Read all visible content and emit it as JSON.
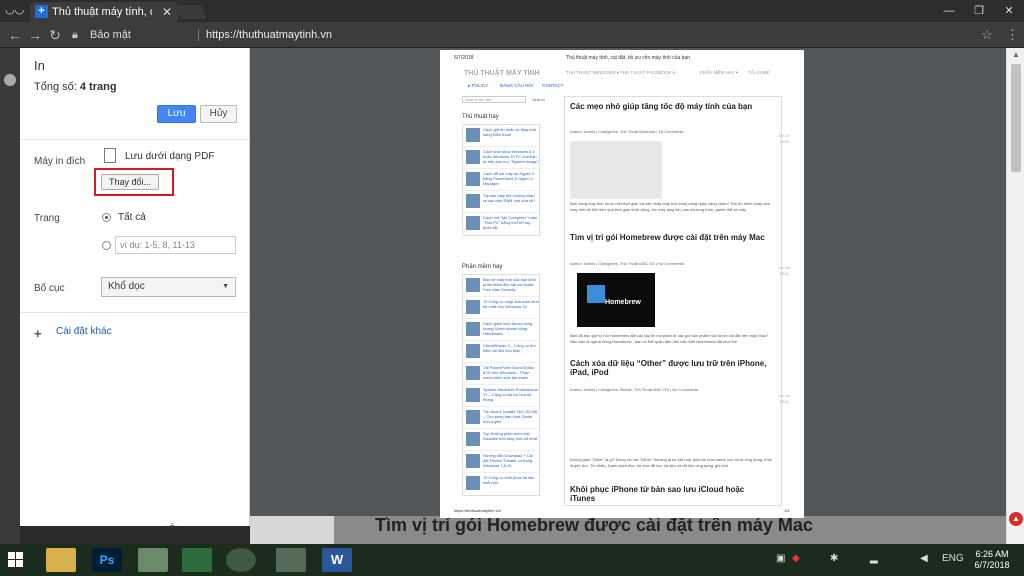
{
  "browser": {
    "tab_title": "Thủ thuật máy tính, cài đ",
    "tab_close": "✕",
    "secure_label": "Bảo mật",
    "url": "https://thuthuatmaytinh.vn",
    "window_minimize": "—",
    "window_maximize": "❐",
    "window_close": "✕"
  },
  "print_panel": {
    "title": "In",
    "total_label": "Tổng số:",
    "total_value": "4 trang",
    "save_button": "Lưu",
    "cancel_button": "Hủy",
    "destination_label": "Máy in đích",
    "destination_value": "Lưu dưới dạng PDF",
    "change_button": "Thay đổi...",
    "pages_label": "Trang",
    "pages_all": "Tất cả",
    "pages_placeholder": "ví dụ: 1-5, 8, 11-13",
    "layout_label": "Bố cục",
    "layout_value": "Khổ dọc",
    "more_settings": "Cài đặt khác"
  },
  "preview": {
    "header_date": "6/7/2018",
    "header_title": "Thủ thuật máy tính, cài đặt, tối ưu cho máy tính của bạn",
    "brand": "THỦ THUẬT MÁY TÍNH",
    "top_nav": [
      "THỦ THUẬT WINDOWS ▾",
      "THỦ THUẬT FACEBOOK ▾",
      "PHẦN MỀM HAY ▾",
      "TẢI GAME"
    ],
    "sub_nav": [
      "▸ POLICY",
      "ĐĂNG CÂU HỎI",
      "CONTACT"
    ],
    "search_placeholder": "Search the site",
    "search_button": "Search",
    "sidebar_title_1": "Thủ thuật hay",
    "sidebar_items_1": [
      "Cách gửi tin nhắn từ Máy tính sang Điện thoại",
      "Cách khôi phục Windows 8.1 hoặc Windows 10 PC của bạn từ bản sao lưu \"System Image\"",
      "Cách để cài máy ảo Hyper-V bằng PowerShell & Hyper-V Manager",
      "Tại sao máy tính không nhận ra các chip RAM mới của tôi?",
      "Cách mở \"My Computer\" hoặc \"This PC\" bằng một tổ hợp phím tắt"
    ],
    "sidebar_title_2": "Phần mềm hay",
    "sidebar_items_2": [
      "Bảo vệ máy tính của bạn khỏi phần mềm độc hại với Avast Free Mac Security",
      "10 Công cụ chụp ảnh màn hình tốt nhất cho Windows 10",
      "Cách giảm kích thước dung lượng Video nhanh bằng Handbrake",
      "CheatWhaler 3 – Công cụ tìm kiếm tài liệu cho Mac",
      "Tải PowerPoint Sound Editor 8.02 cho Windows – Phần mềm chỉnh sửa âm thanh",
      "System Mechanic Professional 17 – Công cụ tối ưu hóa hệ thống",
      "Tải Java 8 Update 162 (32-bit) – Cho phép bạn chơi Game trực tuyến",
      "Top Những phần mềm hát Karaoke trên Máy tính tốt nhất",
      "Hướng dẫn Download + Cài đặt Firefox Theater v4 trong Windows 7,8,10",
      "10 Công cụ khôi phục tài liệu miễn phí"
    ],
    "posts": [
      {
        "title": "Các mẹo nhỏ giúp tăng tốc độ máy tính của bạn",
        "meta": "Author: Admin | Categories: Thủ Thuật Windows | 16 Comments",
        "date": "Jun 07 2018",
        "excerpt": "Bạn đang mày tính được mệt thời gian và cảm thấy máy tính chạy càng ngày càng chậm? Rồi đó thêm chạy của máy tính sẽ thể hiện qua thời gian khởi động, tốc máy lạng lần, các chương trình, game thể và máy"
      },
      {
        "title": "Tìm vị trí gói Homebrew được cài đặt trên máy Mac",
        "meta": "Author: Admin | Categories: Thủ Thuật MAC OS | No Comments",
        "date": "Jun 06 2018",
        "excerpt": "Bạn đã bao giờ tự hỏi Homebrew đặt các tập tin mà phần tử các gói sản phẩm nào được cài đặt trên máy Mac? Nếu bạn là người dùng Homebrew , bạn có thể quan tâm đến việc biết Homebrew đặt như thế"
      },
      {
        "title": "Cách xóa dữ liệu “Other” được lưu trữ trên iPhone, iPad, iPod",
        "meta": "Author: Admin | Categories: Mobile, Thủ Thuật MAC OS | No Comments",
        "date": "Jun 04 2018",
        "excerpt": "Không gian “Other” là gì? Đúng lưu trữ “Other” thường là sự kết hợp giữa bộ nhớ cache cục bộ từ ứng dụng, trình duyệt, thư, Tin nhắn, Danh sách đọc, bộ chia để lưu, tài liệu và dữ liệu ứng dụng, ghi chú"
      },
      {
        "title": "Khôi phục iPhone từ bản sao lưu iCloud hoặc iTunes",
        "meta": "",
        "date": "",
        "excerpt": ""
      }
    ],
    "homebrew_label": "Homebrew",
    "footer_url": "https://thuthuatmaytinh.vn/",
    "footer_page": "1/4"
  },
  "background_page": {
    "bottom_heading": "Tìm vị trí gói Homebrew được cài đặt trên máy Mac",
    "left_fragment": "tắt"
  },
  "taskbar": {
    "ps_label": "Ps",
    "word_label": "W",
    "language": "ENG",
    "time": "6:26 AM",
    "date": "6/7/2018"
  }
}
